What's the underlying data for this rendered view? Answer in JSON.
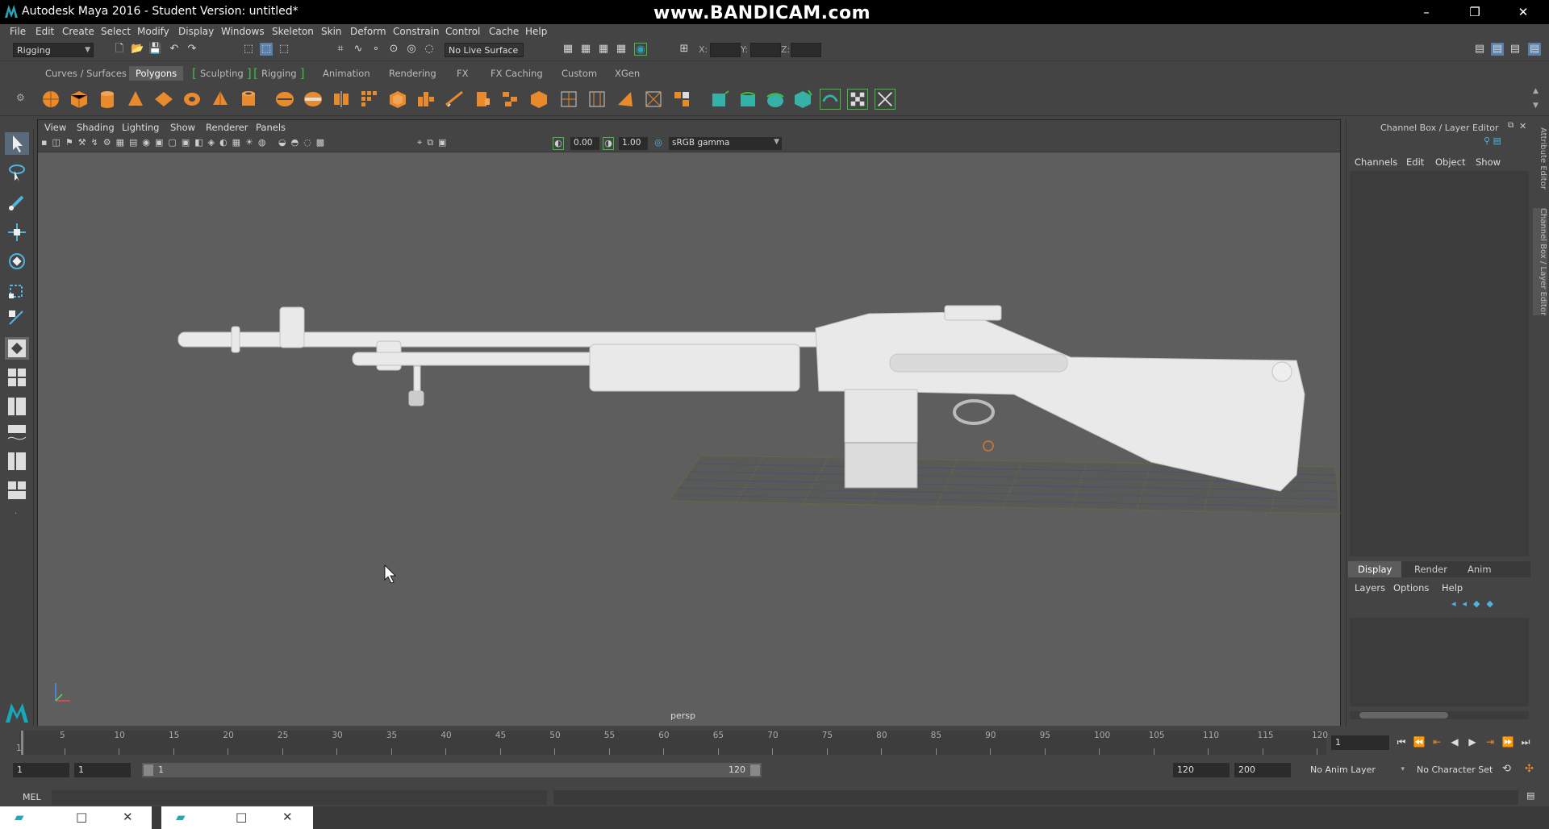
{
  "window": {
    "title": "Autodesk Maya 2016 - Student Version: untitled*",
    "watermark": "www.BANDICAM.com",
    "minimize": "–",
    "restore": "❐",
    "close": "✕"
  },
  "menubar": [
    "File",
    "Edit",
    "Create",
    "Select",
    "Modify",
    "Display",
    "Windows",
    "Skeleton",
    "Skin",
    "Deform",
    "Constrain",
    "Control",
    "Cache",
    "Help"
  ],
  "statusline": {
    "mode": "Rigging",
    "live_surface": "No Live Surface",
    "coord_x_label": "X:",
    "coord_y_label": "Y:",
    "coord_z_label": "Z:"
  },
  "shelf_tabs": [
    "Curves / Surfaces",
    "Polygons",
    "Sculpting",
    "Rigging",
    "Animation",
    "Rendering",
    "FX",
    "FX Caching",
    "Custom",
    "XGen"
  ],
  "shelf_active": "Polygons",
  "viewport": {
    "menu": [
      "View",
      "Shading",
      "Lighting",
      "Show",
      "Renderer",
      "Panels"
    ],
    "exposure": "0.00",
    "gamma": "1.00",
    "color_space": "sRGB gamma",
    "camera_label": "persp"
  },
  "channel_box": {
    "title": "Channel Box / Layer Editor",
    "menu": [
      "Channels",
      "Edit",
      "Object",
      "Show"
    ],
    "layer_tabs": [
      "Display",
      "Render",
      "Anim"
    ],
    "layer_active": "Display",
    "layer_menu": [
      "Layers",
      "Options",
      "Help"
    ],
    "side_tabs": [
      "Attribute Editor",
      "Channel Box / Layer Editor"
    ]
  },
  "timeline": {
    "ticks": [
      "1",
      "5",
      "10",
      "15",
      "20",
      "25",
      "30",
      "35",
      "40",
      "45",
      "50",
      "55",
      "60",
      "65",
      "70",
      "75",
      "80",
      "85",
      "90",
      "95",
      "100",
      "105",
      "110",
      "115",
      "120"
    ],
    "current_frame": "1"
  },
  "range": {
    "start": "1",
    "inner_start": "1",
    "slider_start": "1",
    "slider_end": "120",
    "end": "120",
    "outer_end": "200",
    "anim_layer": "No Anim Layer",
    "character_set": "No Character Set"
  },
  "command_line": {
    "label": "MEL"
  },
  "taskbar": {
    "restore": "□",
    "close": "✕"
  }
}
